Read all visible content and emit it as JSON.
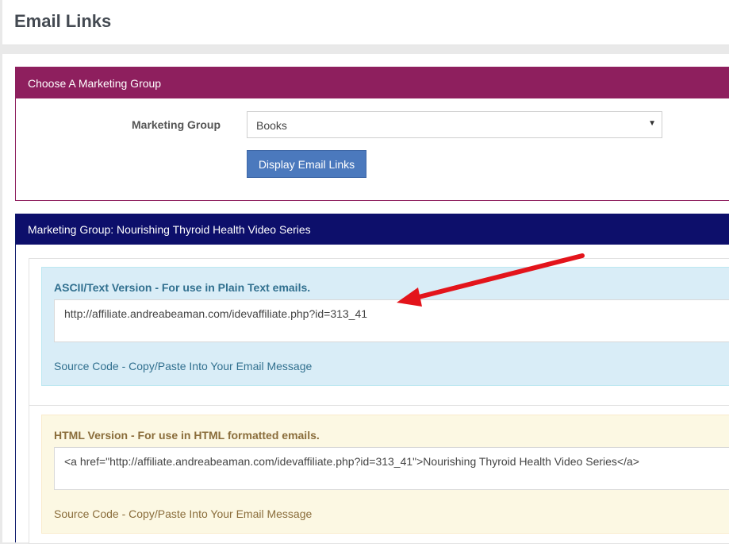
{
  "header": {
    "title": "Email Links"
  },
  "choose_panel": {
    "heading": "Choose A Marketing Group",
    "field_label": "Marketing Group",
    "select_value": "Books",
    "button_label": "Display Email Links"
  },
  "results_panel": {
    "heading": "Marketing Group: Nourishing Thyroid Health Video Series",
    "ascii": {
      "title": "ASCII/Text Version - For use in Plain Text emails.",
      "code": "http://affiliate.andreabeaman.com/idevaffiliate.php?id=313_41",
      "caption": "Source Code - Copy/Paste Into Your Email Message"
    },
    "html": {
      "title": "HTML Version - For use in HTML formatted emails.",
      "code": "<a href=\"http://affiliate.andreabeaman.com/idevaffiliate.php?id=313_41\">Nourishing Thyroid Health Video Series</a>",
      "caption": "Source Code - Copy/Paste Into Your Email Message"
    }
  },
  "colors": {
    "choose_heading": "#8e1f5e",
    "results_heading": "#0d0f6b",
    "button": "#4b79bd",
    "arrow": "#e3141b"
  }
}
